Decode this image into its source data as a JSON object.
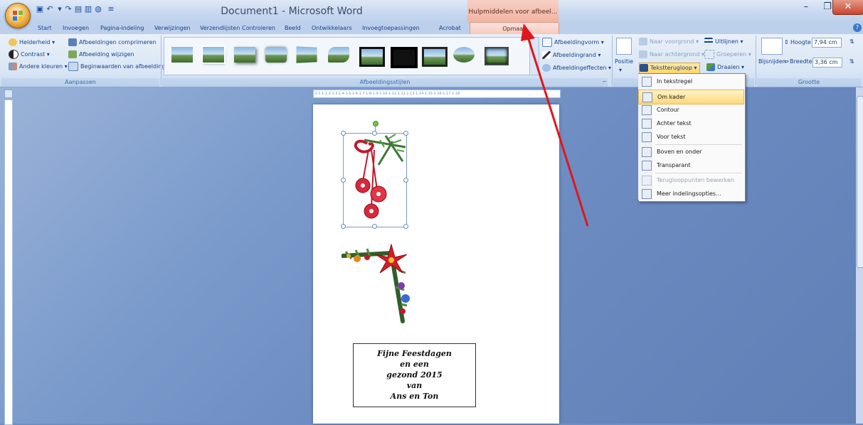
{
  "window": {
    "title": "Document1 - Microsoft Word",
    "context_title": "Hulpmiddelen voor afbeel...",
    "minimize": "–",
    "maximize": "❐",
    "close": "✕"
  },
  "tabs": [
    "Start",
    "Invoegen",
    "Pagina-indeling",
    "Verwijzingen",
    "Verzendlijsten",
    "Controleren",
    "Beeld",
    "Ontwikkelaars",
    "Invoegtoepassingen",
    "Acrobat"
  ],
  "active_tab": "Opmaak",
  "ribbon": {
    "aanpassen": {
      "label": "Aanpassen",
      "helderheid": "Helderheid ▾",
      "contrast": "Contrast ▾",
      "andere_kleuren": "Andere kleuren ▾",
      "comprimeren": "Afbeeldingen comprimeren",
      "wijzigen": "Afbeelding wijzigen",
      "beginwaarden": "Beginwaarden van afbeelding"
    },
    "stijlen": {
      "label": "Afbeeldingsstijlen",
      "vorm": "Afbeeldingvorm ▾",
      "rand": "Afbeeldingrand ▾",
      "effecten": "Afbeeldingeffecten ▾"
    },
    "schikken": {
      "positie": "Positie",
      "voorgrond": "Naar voorgrond ▾",
      "achtergrond": "Naar achtergrond ▾",
      "tekstterugloop": "Tekstterugloop ▾",
      "uitlijnen": "Uitlijnen ▾",
      "groeperen": "Groeperen ▾",
      "draaien": "Draaien ▾"
    },
    "grootte": {
      "label": "Grootte",
      "bijsnijden": "Bijsnijden",
      "hoogte_label": "Hoogte:",
      "hoogte": "7,94 cm",
      "breedte_label": "Breedte:",
      "breedte": "3,36 cm"
    }
  },
  "menu": {
    "items": [
      "In tekstregel",
      "Om kader",
      "Contour",
      "Achter tekst",
      "Voor tekst",
      "Boven en onder",
      "Transparant",
      "Terugloop­punten bewerken",
      "Meer indelingsopties..."
    ],
    "highlighted_index": 1
  },
  "document": {
    "greeting": [
      "Fijne Feestdagen",
      "en een",
      "gezond 2015",
      "van",
      "Ans en Ton"
    ]
  },
  "colors": {
    "accent": "#15428b",
    "context": "#f7c8bb",
    "arrow": "#e0161d"
  }
}
